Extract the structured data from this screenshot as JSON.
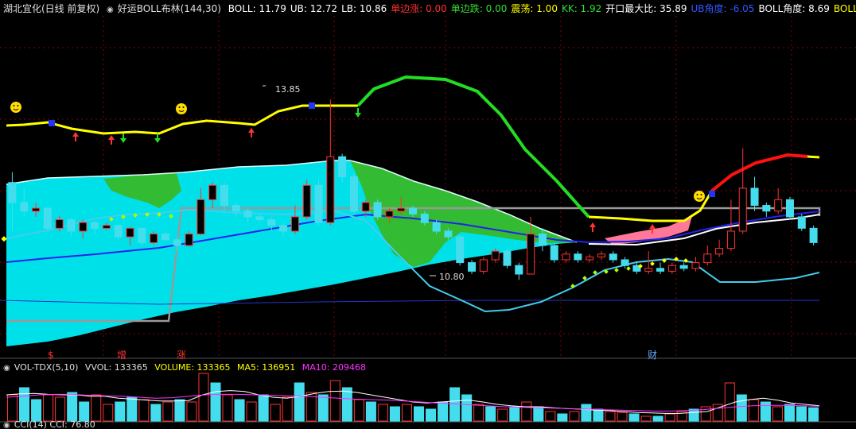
{
  "header": {
    "stock_title": "湖北宜化(日线 前复权)",
    "indicator_name": "好运BOLL布林(144,30)",
    "items": [
      {
        "label": "BOLL: 11.79",
        "color": "#ffffff"
      },
      {
        "label": "UB: 12.72",
        "color": "#ffffff"
      },
      {
        "label": "LB: 10.86",
        "color": "#ffffff"
      },
      {
        "label": "单边涨: 0.00",
        "color": "#ff3030"
      },
      {
        "label": "单边跌: 0.00",
        "color": "#33dd33"
      },
      {
        "label": "震荡: 1.00",
        "color": "#ffff00"
      },
      {
        "label": "KK: 1.92",
        "color": "#33dd33"
      },
      {
        "label": "开口最大比: 35.89",
        "color": "#ffffff"
      },
      {
        "label": "UB角度: -6.05",
        "color": "#3355ff"
      },
      {
        "label": "BOLL角度: 8.69",
        "color": "#ffffff"
      },
      {
        "label": "BOLL最大角",
        "color": "#ffff00"
      }
    ]
  },
  "annotations": {
    "high_label": "13.85",
    "low_label": "10.80",
    "markers": [
      {
        "text": "$",
        "color": "#ff3030"
      },
      {
        "text": "增",
        "color": "#ff3030"
      },
      {
        "text": "涨",
        "color": "#ff3030"
      },
      {
        "text": "财",
        "color": "#66aaff"
      }
    ]
  },
  "volume_header": {
    "name": "VOL-TDX(5,10)",
    "vvol": "VVOL: 133365",
    "volume": "VOLUME: 133365",
    "ma5": "MA5: 136951",
    "ma10": "MA10: 209468"
  },
  "cci_header": {
    "label": "CCI(14)  CCI: 76.80"
  },
  "colors": {
    "up": "#ff3333",
    "down": "#44ddee",
    "fill_cyan": "#00e0e8",
    "fill_green": "#33bb33",
    "mid_line": "#2222ee",
    "ub_yellow": "#ffff00",
    "ub_green": "#22dd22",
    "ub_red": "#ff1111",
    "grid": "#8b0000",
    "ma5": "#ffffff",
    "ma10": "#ff33ff"
  },
  "chart_data": {
    "type": "candlestick",
    "price_range": [
      10.0,
      15.0
    ],
    "candles": [
      [
        12.4,
        12.05,
        12.58,
        11.55
      ],
      [
        12.05,
        11.9,
        12.3,
        11.82
      ],
      [
        11.9,
        11.95,
        12.05,
        11.8
      ],
      [
        11.95,
        11.6,
        11.98,
        11.55
      ],
      [
        11.6,
        11.75,
        11.82,
        11.55
      ],
      [
        11.75,
        11.55,
        11.78,
        11.45
      ],
      [
        11.55,
        11.7,
        11.75,
        11.42
      ],
      [
        11.7,
        11.6,
        11.72,
        11.5
      ],
      [
        11.6,
        11.65,
        11.7,
        11.58
      ],
      [
        11.65,
        11.45,
        11.68,
        11.4
      ],
      [
        11.45,
        11.6,
        11.62,
        11.3
      ],
      [
        11.6,
        11.35,
        11.62,
        11.3
      ],
      [
        11.35,
        11.5,
        11.55,
        11.32
      ],
      [
        11.5,
        11.4,
        11.55,
        11.38
      ],
      [
        11.4,
        11.3,
        11.45,
        11.2
      ],
      [
        11.3,
        11.5,
        11.55,
        11.28
      ],
      [
        11.5,
        12.1,
        12.3,
        11.48
      ],
      [
        12.1,
        12.35,
        12.4,
        11.95
      ],
      [
        12.35,
        12.0,
        12.4,
        11.9
      ],
      [
        12.0,
        11.9,
        12.05,
        11.8
      ],
      [
        11.9,
        11.8,
        11.95,
        11.7
      ],
      [
        11.8,
        11.75,
        11.85,
        11.7
      ],
      [
        11.75,
        11.65,
        11.8,
        11.55
      ],
      [
        11.65,
        11.55,
        11.7,
        11.45
      ],
      [
        11.55,
        11.8,
        12.0,
        11.5
      ],
      [
        11.8,
        12.35,
        12.45,
        11.75
      ],
      [
        12.35,
        11.7,
        12.45,
        11.65
      ],
      [
        11.7,
        12.85,
        13.85,
        11.65
      ],
      [
        12.85,
        12.5,
        12.9,
        12.4
      ],
      [
        12.5,
        11.9,
        12.55,
        11.85
      ],
      [
        11.9,
        12.05,
        12.1,
        11.8
      ],
      [
        12.05,
        11.8,
        12.1,
        11.75
      ],
      [
        11.8,
        11.9,
        11.95,
        11.7
      ],
      [
        11.9,
        11.95,
        12.15,
        11.85
      ],
      [
        11.95,
        11.85,
        12.0,
        11.8
      ],
      [
        11.85,
        11.7,
        11.9,
        11.65
      ],
      [
        11.7,
        11.55,
        11.75,
        11.5
      ],
      [
        11.55,
        11.45,
        11.6,
        11.4
      ],
      [
        11.45,
        11.0,
        11.5,
        10.95
      ],
      [
        11.0,
        10.85,
        11.05,
        10.8
      ],
      [
        10.85,
        11.05,
        11.1,
        10.8
      ],
      [
        11.05,
        11.2,
        11.25,
        11.0
      ],
      [
        11.2,
        10.95,
        11.25,
        10.9
      ],
      [
        10.95,
        10.8,
        11.0,
        10.7
      ],
      [
        10.8,
        11.5,
        11.8,
        10.8
      ],
      [
        11.5,
        11.3,
        11.6,
        11.2
      ],
      [
        11.3,
        11.05,
        11.35,
        11.0
      ],
      [
        11.05,
        11.15,
        11.2,
        11.0
      ],
      [
        11.15,
        11.05,
        11.2,
        11.0
      ],
      [
        11.05,
        11.1,
        11.15,
        11.0
      ],
      [
        11.1,
        11.15,
        11.2,
        11.05
      ],
      [
        11.15,
        11.05,
        11.2,
        11.0
      ],
      [
        11.05,
        10.95,
        11.1,
        10.9
      ],
      [
        10.95,
        10.85,
        11.0,
        10.8
      ],
      [
        10.85,
        10.9,
        11.2,
        10.8
      ],
      [
        10.9,
        10.85,
        11.0,
        10.8
      ],
      [
        10.85,
        10.95,
        11.0,
        10.8
      ],
      [
        10.95,
        10.9,
        11.0,
        10.85
      ],
      [
        10.9,
        11.0,
        11.1,
        10.85
      ],
      [
        11.0,
        11.15,
        11.3,
        10.95
      ],
      [
        11.15,
        11.25,
        11.4,
        11.1
      ],
      [
        11.25,
        11.55,
        12.1,
        11.2
      ],
      [
        11.55,
        12.3,
        13.0,
        11.5
      ],
      [
        12.3,
        12.0,
        12.5,
        11.9
      ],
      [
        12.0,
        11.9,
        12.05,
        11.8
      ],
      [
        11.9,
        12.1,
        12.3,
        11.85
      ],
      [
        12.1,
        11.8,
        12.15,
        11.75
      ],
      [
        11.8,
        11.6,
        11.85,
        11.55
      ],
      [
        11.6,
        11.35,
        11.65,
        11.3
      ]
    ],
    "ub_line": [
      13.2,
      13.22,
      13.2,
      13.18,
      13.18,
      13.15,
      13.15,
      13.15,
      13.15,
      13.18,
      13.18,
      13.15,
      13.15,
      13.12,
      13.1,
      13.05,
      13.15,
      13.25,
      13.28,
      13.28,
      13.22,
      13.15,
      13.2,
      13.3,
      13.35,
      13.45,
      13.48,
      13.48,
      13.5,
      13.5,
      13.5,
      13.5,
      13.5,
      13.6,
      13.95,
      14.15,
      14.2,
      14.2,
      14.2,
      14.15,
      14.0,
      13.8,
      13.5,
      13.1,
      12.6,
      12.1,
      11.6,
      11.4,
      11.38,
      11.38,
      11.36,
      11.36,
      11.35,
      11.36,
      11.4,
      11.5,
      11.8,
      12.3,
      12.6,
      12.7,
      12.75,
      12.72
    ],
    "boll_mid": [
      10.95,
      11.0,
      11.02,
      11.05,
      11.07,
      11.1,
      11.12,
      11.15,
      11.17,
      11.2,
      11.22,
      11.25,
      11.28,
      11.3,
      11.32,
      11.35,
      11.38,
      11.4,
      11.4,
      11.39,
      11.37,
      11.34,
      11.3,
      11.26,
      11.22,
      11.18,
      11.15,
      11.1,
      11.1,
      11.1,
      11.12,
      11.18,
      11.3,
      11.42,
      11.55,
      11.68,
      11.79
    ]
  },
  "volume_data": {
    "bars": [
      {
        "v": 0.55,
        "c": "up"
      },
      {
        "v": 0.7,
        "c": "down"
      },
      {
        "v": 0.45,
        "c": "down"
      },
      {
        "v": 0.55,
        "c": "up"
      },
      {
        "v": 0.5,
        "c": "up"
      },
      {
        "v": 0.6,
        "c": "down"
      },
      {
        "v": 0.4,
        "c": "down"
      },
      {
        "v": 0.55,
        "c": "up"
      },
      {
        "v": 0.35,
        "c": "up"
      },
      {
        "v": 0.4,
        "c": "down"
      },
      {
        "v": 0.5,
        "c": "down"
      },
      {
        "v": 0.45,
        "c": "up"
      },
      {
        "v": 0.35,
        "c": "down"
      },
      {
        "v": 0.4,
        "c": "up"
      },
      {
        "v": 0.45,
        "c": "down"
      },
      {
        "v": 0.4,
        "c": "up"
      },
      {
        "v": 1.0,
        "c": "up"
      },
      {
        "v": 0.8,
        "c": "down"
      },
      {
        "v": 0.55,
        "c": "up"
      },
      {
        "v": 0.45,
        "c": "down"
      },
      {
        "v": 0.4,
        "c": "up"
      },
      {
        "v": 0.55,
        "c": "down"
      },
      {
        "v": 0.35,
        "c": "up"
      },
      {
        "v": 0.5,
        "c": "up"
      },
      {
        "v": 0.8,
        "c": "down"
      },
      {
        "v": 0.6,
        "c": "up"
      },
      {
        "v": 0.55,
        "c": "down"
      },
      {
        "v": 0.85,
        "c": "up"
      },
      {
        "v": 0.7,
        "c": "down"
      },
      {
        "v": 0.45,
        "c": "up"
      },
      {
        "v": 0.4,
        "c": "down"
      },
      {
        "v": 0.35,
        "c": "up"
      },
      {
        "v": 0.3,
        "c": "down"
      },
      {
        "v": 0.35,
        "c": "up"
      },
      {
        "v": 0.3,
        "c": "down"
      },
      {
        "v": 0.25,
        "c": "down"
      },
      {
        "v": 0.4,
        "c": "down"
      },
      {
        "v": 0.7,
        "c": "down"
      },
      {
        "v": 0.55,
        "c": "down"
      },
      {
        "v": 0.35,
        "c": "up"
      },
      {
        "v": 0.3,
        "c": "down"
      },
      {
        "v": 0.25,
        "c": "up"
      },
      {
        "v": 0.3,
        "c": "down"
      },
      {
        "v": 0.4,
        "c": "up"
      },
      {
        "v": 0.3,
        "c": "down"
      },
      {
        "v": 0.2,
        "c": "up"
      },
      {
        "v": 0.15,
        "c": "down"
      },
      {
        "v": 0.2,
        "c": "up"
      },
      {
        "v": 0.35,
        "c": "down"
      },
      {
        "v": 0.25,
        "c": "down"
      },
      {
        "v": 0.2,
        "c": "up"
      },
      {
        "v": 0.18,
        "c": "up"
      },
      {
        "v": 0.15,
        "c": "down"
      },
      {
        "v": 0.1,
        "c": "up"
      },
      {
        "v": 0.1,
        "c": "down"
      },
      {
        "v": 0.15,
        "c": "up"
      },
      {
        "v": 0.2,
        "c": "up"
      },
      {
        "v": 0.25,
        "c": "down"
      },
      {
        "v": 0.3,
        "c": "up"
      },
      {
        "v": 0.35,
        "c": "up"
      },
      {
        "v": 0.8,
        "c": "up"
      },
      {
        "v": 0.55,
        "c": "down"
      },
      {
        "v": 0.45,
        "c": "up"
      },
      {
        "v": 0.4,
        "c": "down"
      },
      {
        "v": 0.3,
        "c": "up"
      },
      {
        "v": 0.35,
        "c": "down"
      },
      {
        "v": 0.3,
        "c": "down"
      },
      {
        "v": 0.28,
        "c": "down"
      }
    ],
    "ma5": [
      0.55,
      0.57,
      0.58,
      0.56,
      0.55,
      0.55,
      0.52,
      0.52,
      0.48,
      0.46,
      0.44,
      0.42,
      0.42,
      0.43,
      0.55,
      0.62,
      0.64,
      0.62,
      0.55,
      0.5,
      0.48,
      0.52,
      0.58,
      0.62,
      0.63,
      0.6,
      0.55,
      0.5,
      0.45,
      0.4,
      0.38,
      0.4,
      0.42,
      0.44,
      0.4,
      0.35,
      0.32,
      0.3,
      0.3,
      0.28,
      0.26,
      0.25,
      0.23,
      0.22,
      0.2,
      0.18,
      0.17,
      0.16,
      0.16,
      0.18,
      0.2,
      0.3,
      0.4,
      0.45,
      0.48,
      0.44,
      0.38,
      0.35,
      0.32
    ],
    "ma10": [
      0.5,
      0.52,
      0.55,
      0.56,
      0.56,
      0.54,
      0.53,
      0.52,
      0.5,
      0.48,
      0.49,
      0.52,
      0.55,
      0.56,
      0.56,
      0.55,
      0.54,
      0.53,
      0.52,
      0.5,
      0.48,
      0.46,
      0.45,
      0.44,
      0.42,
      0.4,
      0.38,
      0.36,
      0.34,
      0.32,
      0.3,
      0.29,
      0.28,
      0.27,
      0.26,
      0.25,
      0.24,
      0.23,
      0.22,
      0.21,
      0.21,
      0.22,
      0.24,
      0.27,
      0.3,
      0.32,
      0.33,
      0.33,
      0.32,
      0.31
    ]
  }
}
